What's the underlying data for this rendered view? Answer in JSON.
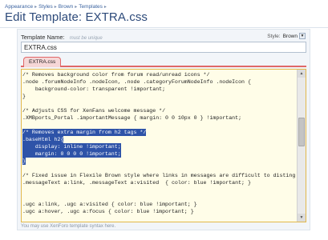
{
  "breadcrumb": [
    "Appearance",
    "Styles",
    "Brown",
    "Templates"
  ],
  "page_title": "Edit Template: EXTRA.css",
  "form": {
    "name_label": "Template Name:",
    "name_hint": "must be unique",
    "name_value": "EXTRA.css",
    "style_label": "Style:",
    "style_value": "Brown",
    "tab_label": "EXTRA.css",
    "footer_note": "You may use XenForo template syntax here."
  },
  "code_lines": [
    "/* Removes background color from forum read/unread icons */",
    ".node .forumNodeInfo .nodeIcon, .node .categoryForumNodeInfo .nodeIcon {",
    "    background-color: transparent !important;",
    "}",
    "",
    "/* Adjusts CSS for XenFans welcome message */",
    ".XMBports_Portal .importantMessage { margin: 0 0 10px 0 } !important;",
    "",
    "/* Removes extra margin from h2 tags */",
    ".baseHtml h2{",
    "    display: inline !important;",
    "    margin: 0 0 0 0 !important;",
    "}",
    "",
    "/* Fixed issue in Flexile Brown style where links in messages are difficult to distinguish */",
    ".messageText a:link, .messageText a:visited  { color: blue !important; }",
    "",
    "",
    ".ugc a:link, .ugc a:visited { color: blue !important; }",
    ".ugc a:hover, .ugc a:focus { color: blue !important; }",
    ""
  ],
  "colors": {
    "selection": "#2e53a8",
    "editor_bg": "#fffde8",
    "tab_accent": "#e06768",
    "title": "#2d4a7a"
  },
  "icons": {
    "dropdown": "chevron-down-icon",
    "scroll_up": "arrow-up-icon",
    "scroll_down": "arrow-down-icon"
  }
}
